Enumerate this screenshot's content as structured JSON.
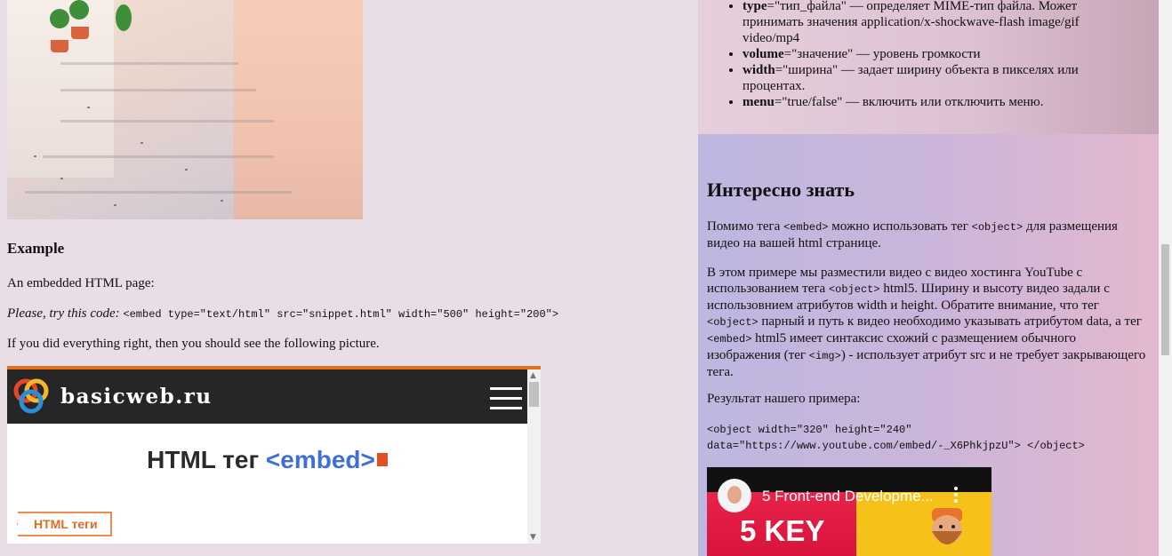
{
  "left": {
    "example_heading": "Example",
    "intro": "An embedded HTML page:",
    "try_prefix": "Please, try this code:",
    "try_code": "<embed type=\"text/html\" src=\"snippet.html\" width=\"500\" height=\"200\">",
    "result_text": "If you did everything right, then you should see the following picture."
  },
  "embed": {
    "logo_text": "basicweb.ru",
    "title_main": "HTML тег ",
    "title_accent": "<embed>",
    "tags_button": "HTML теги",
    "icons": [
      "logo-rings-icon",
      "hamburger-menu-icon",
      "html5-icon",
      "chevron-left-icon",
      "scroll-up-icon",
      "scroll-down-icon"
    ],
    "colors": {
      "header": "#262626",
      "accent": "#3f6ed8",
      "orange": "#e3711f"
    }
  },
  "right": {
    "props": [
      {
        "key": "type",
        "value": "=\"тип_файла\" — определяет MIME-тип файла. Может принимать значения application/x-shockwave-flash image/gif video/mp4"
      },
      {
        "key": "volume",
        "value": "=\"значение\" — уровень громкости"
      },
      {
        "key": "width",
        "value": "=\"ширина\" — задает ширину объекта в пикселях или процентах."
      },
      {
        "key": "menu",
        "value": "=\"true/false\" — включить или отключить меню."
      }
    ],
    "interest_title": "Интересно знать",
    "p1": {
      "a": "Помимо тега ",
      "code1": "<embed>",
      "b": " можно использовать тег ",
      "code2": "<object>",
      "c": " для размещения видео на вашей html странице."
    },
    "p2": {
      "a": "В этом примере мы разместили видео с видео хостинга YouTube с использованием тега ",
      "code1": "<object>",
      "b": " html5. Ширину и высоту видео задали с использовнием атрибутов width и height. Обратите внимание, что тег ",
      "code2": "<object>",
      "c": " парный и путь к видео необходимо указывать атрибутом data, а тег ",
      "code3": "<embed>",
      "d": " html5 имеет синтаксис схожий с размещением обычного изображения (тег ",
      "code4": "<img>",
      "e": ") - использует атрибут src и не требует закрывающего тега."
    },
    "p3": "Результат нашего примера:",
    "code_line1": "<object width=\"320\" height=\"240\"",
    "code_line2": "data=\"https://www.youtube.com/embed/-_X6PhkjpzU\"> </object>",
    "video": {
      "title": "5 Front-end Developme...",
      "big_text": "5 KEY"
    }
  }
}
